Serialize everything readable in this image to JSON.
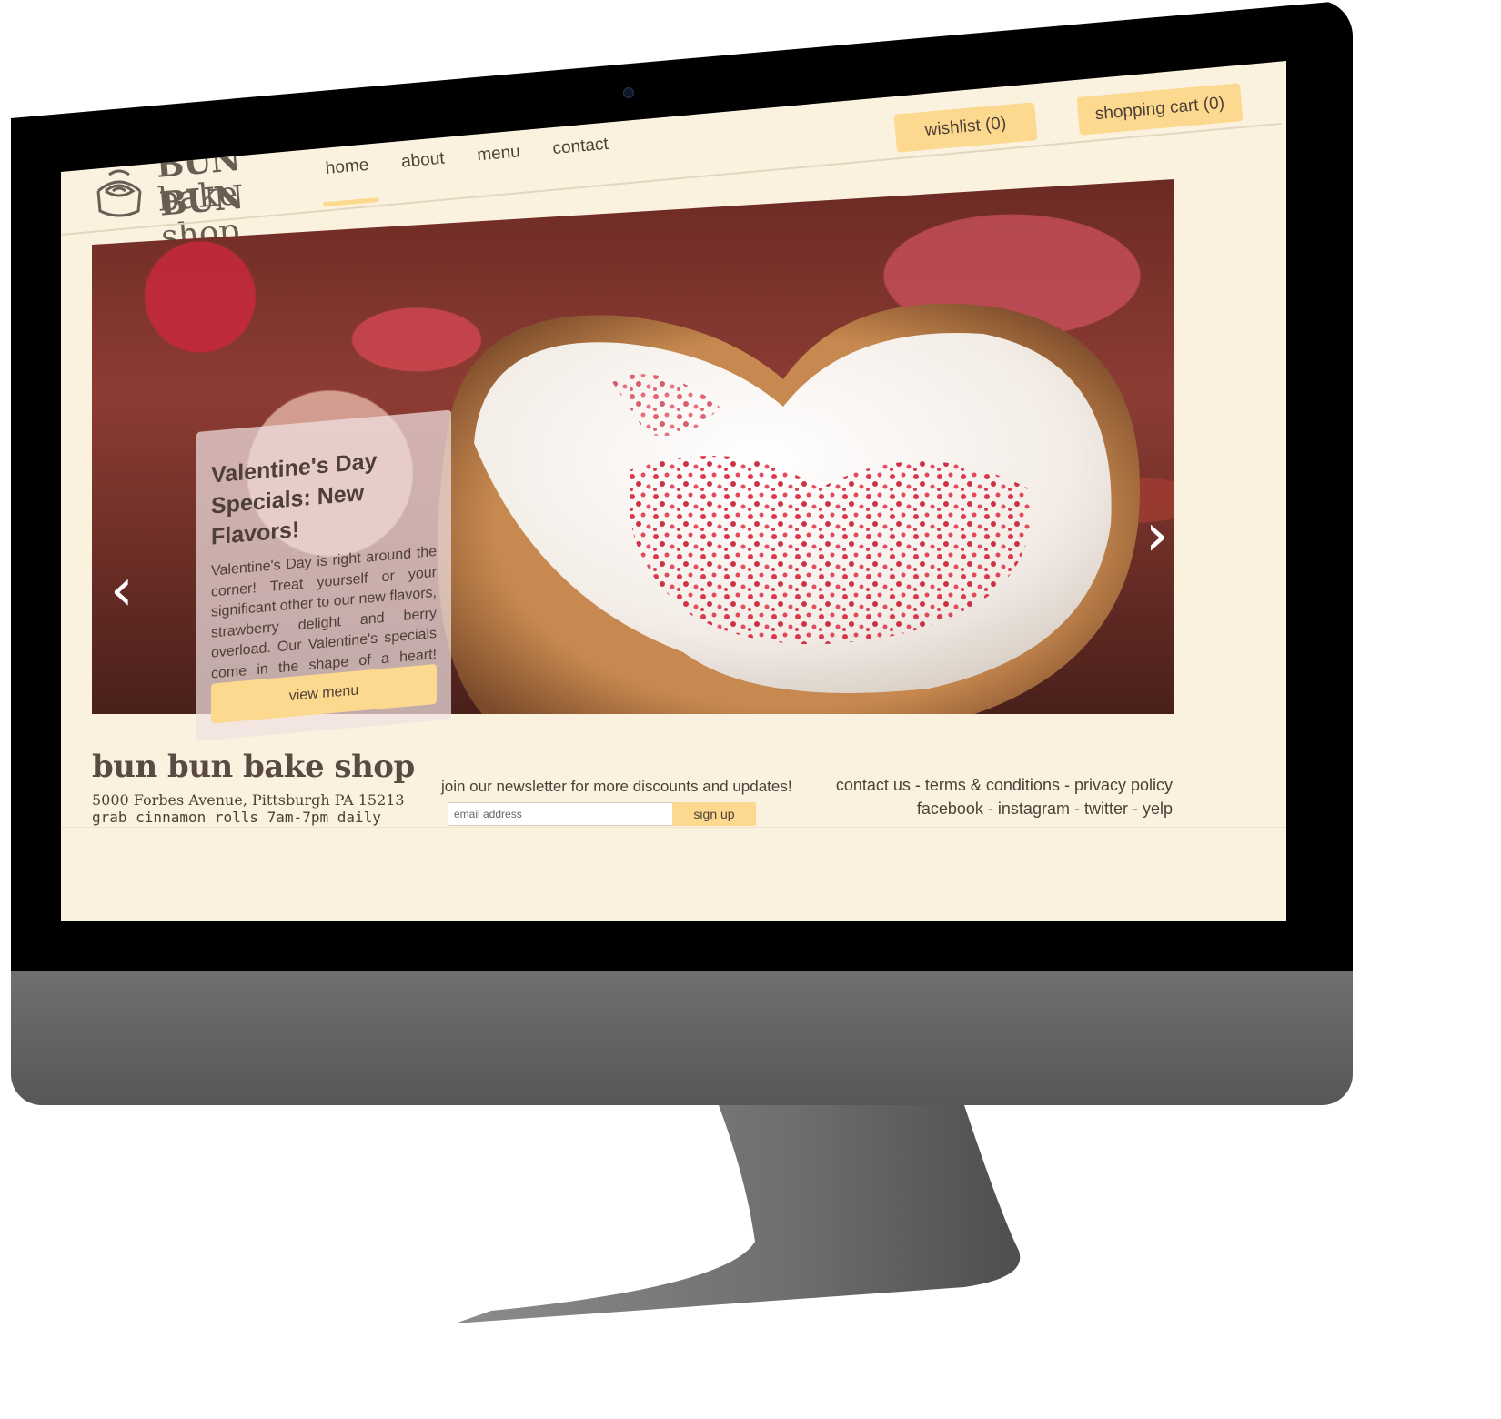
{
  "header": {
    "wishlist_label": "wishlist (0)",
    "cart_label": "shopping cart (0)"
  },
  "logo": {
    "line1": "BUN BUN",
    "line2": "bake shop",
    "icon": "cinnamon-roll-icon"
  },
  "nav": {
    "items": [
      {
        "label": "home",
        "active": true
      },
      {
        "label": "about",
        "active": false
      },
      {
        "label": "menu",
        "active": false
      },
      {
        "label": "contact",
        "active": false
      }
    ]
  },
  "hero": {
    "promo_title": "Valentine's Day Specials: New Flavors!",
    "promo_body": "Valentine's Day is right around the corner! Treat yourself or your significant other to our new flavors, strawberry delight and berry overload. Our Valentine's specials come in the shape of a heart! Available for a limited time only.",
    "button_label": "view menu",
    "prev_icon": "chevron-left-icon",
    "next_icon": "chevron-right-icon",
    "slide_count": 4,
    "active_slide": 1
  },
  "footer": {
    "brand": "bun bun bake shop",
    "address": "5000 Forbes Avenue, Pittsburgh PA 15213",
    "hours": "grab cinnamon rolls 7am-7pm daily",
    "newsletter_text": "join our newsletter for more discounts and updates!",
    "email_placeholder": "email address",
    "signup_label": "sign up",
    "links_row1": [
      "contact us",
      "terms & conditions",
      "privacy policy"
    ],
    "links_row2": [
      "facebook",
      "instagram",
      "twitter",
      "yelp"
    ],
    "separator": " - "
  },
  "colors": {
    "background": "#fbf1df",
    "accent": "#fcd98f",
    "text": "#4e4037",
    "bezel": "#000000",
    "chin": "#5f5f5f"
  }
}
